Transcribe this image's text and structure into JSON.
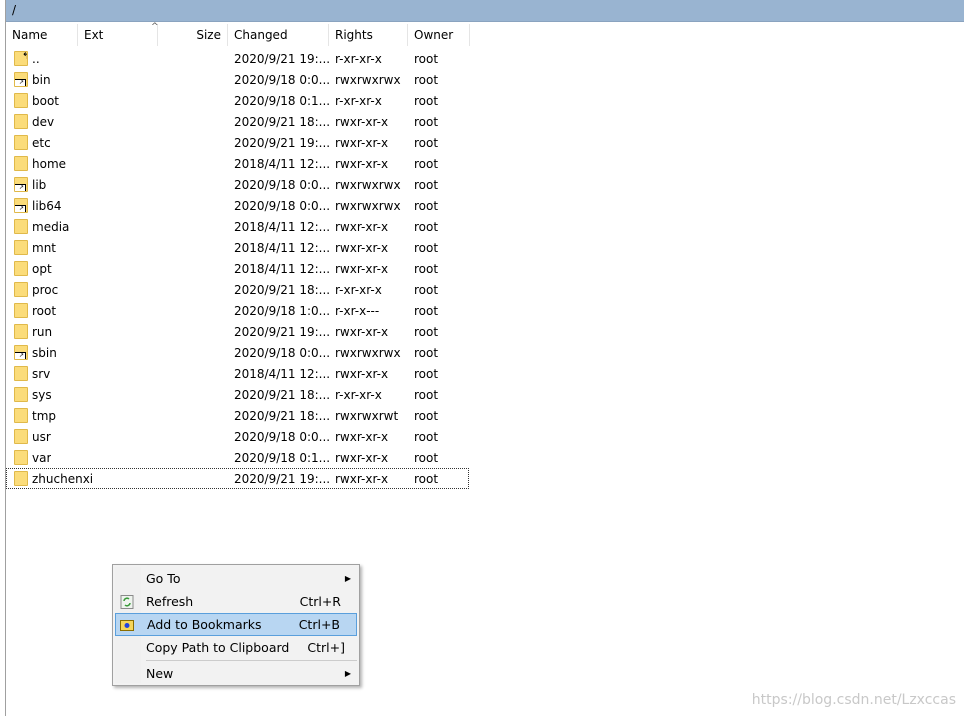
{
  "path": "/",
  "columns": {
    "name": "Name",
    "ext": "Ext",
    "size": "Size",
    "changed": "Changed",
    "rights": "Rights",
    "owner": "Owner"
  },
  "rows": [
    {
      "name": "..",
      "changed": "2020/9/21 19:...",
      "rights": "r-xr-xr-x",
      "owner": "root",
      "icon": "parent-folder"
    },
    {
      "name": "bin",
      "changed": "2020/9/18 0:0...",
      "rights": "rwxrwxrwx",
      "owner": "root",
      "icon": "link-folder"
    },
    {
      "name": "boot",
      "changed": "2020/9/18 0:1...",
      "rights": "r-xr-xr-x",
      "owner": "root",
      "icon": "folder"
    },
    {
      "name": "dev",
      "changed": "2020/9/21 18:...",
      "rights": "rwxr-xr-x",
      "owner": "root",
      "icon": "folder"
    },
    {
      "name": "etc",
      "changed": "2020/9/21 19:...",
      "rights": "rwxr-xr-x",
      "owner": "root",
      "icon": "folder"
    },
    {
      "name": "home",
      "changed": "2018/4/11 12:...",
      "rights": "rwxr-xr-x",
      "owner": "root",
      "icon": "folder"
    },
    {
      "name": "lib",
      "changed": "2020/9/18 0:0...",
      "rights": "rwxrwxrwx",
      "owner": "root",
      "icon": "link-folder"
    },
    {
      "name": "lib64",
      "changed": "2020/9/18 0:0...",
      "rights": "rwxrwxrwx",
      "owner": "root",
      "icon": "link-folder"
    },
    {
      "name": "media",
      "changed": "2018/4/11 12:...",
      "rights": "rwxr-xr-x",
      "owner": "root",
      "icon": "folder"
    },
    {
      "name": "mnt",
      "changed": "2018/4/11 12:...",
      "rights": "rwxr-xr-x",
      "owner": "root",
      "icon": "folder"
    },
    {
      "name": "opt",
      "changed": "2018/4/11 12:...",
      "rights": "rwxr-xr-x",
      "owner": "root",
      "icon": "folder"
    },
    {
      "name": "proc",
      "changed": "2020/9/21 18:...",
      "rights": "r-xr-xr-x",
      "owner": "root",
      "icon": "folder"
    },
    {
      "name": "root",
      "changed": "2020/9/18 1:0...",
      "rights": "r-xr-x---",
      "owner": "root",
      "icon": "folder"
    },
    {
      "name": "run",
      "changed": "2020/9/21 19:...",
      "rights": "rwxr-xr-x",
      "owner": "root",
      "icon": "folder"
    },
    {
      "name": "sbin",
      "changed": "2020/9/18 0:0...",
      "rights": "rwxrwxrwx",
      "owner": "root",
      "icon": "link-folder"
    },
    {
      "name": "srv",
      "changed": "2018/4/11 12:...",
      "rights": "rwxr-xr-x",
      "owner": "root",
      "icon": "folder"
    },
    {
      "name": "sys",
      "changed": "2020/9/21 18:...",
      "rights": "r-xr-xr-x",
      "owner": "root",
      "icon": "folder"
    },
    {
      "name": "tmp",
      "changed": "2020/9/21 18:...",
      "rights": "rwxrwxrwt",
      "owner": "root",
      "icon": "folder"
    },
    {
      "name": "usr",
      "changed": "2020/9/18 0:0...",
      "rights": "rwxr-xr-x",
      "owner": "root",
      "icon": "folder"
    },
    {
      "name": "var",
      "changed": "2020/9/18 0:1...",
      "rights": "rwxr-xr-x",
      "owner": "root",
      "icon": "folder"
    },
    {
      "name": "zhuchenxi",
      "changed": "2020/9/21 19:...",
      "rights": "rwxr-xr-x",
      "owner": "root",
      "icon": "folder"
    }
  ],
  "menu": {
    "goto": "Go To",
    "refresh": "Refresh",
    "refresh_sc": "Ctrl+R",
    "bookmark": "Add to Bookmarks",
    "bookmark_sc": "Ctrl+B",
    "copy": "Copy Path to Clipboard",
    "copy_sc": "Ctrl+]",
    "new": "New"
  },
  "watermark": "https://blog.csdn.net/Lzxccas",
  "colors": {
    "pathbar": "#99b4d1",
    "highlight": "#b8d6f2",
    "folder": "#fbdc7a"
  }
}
